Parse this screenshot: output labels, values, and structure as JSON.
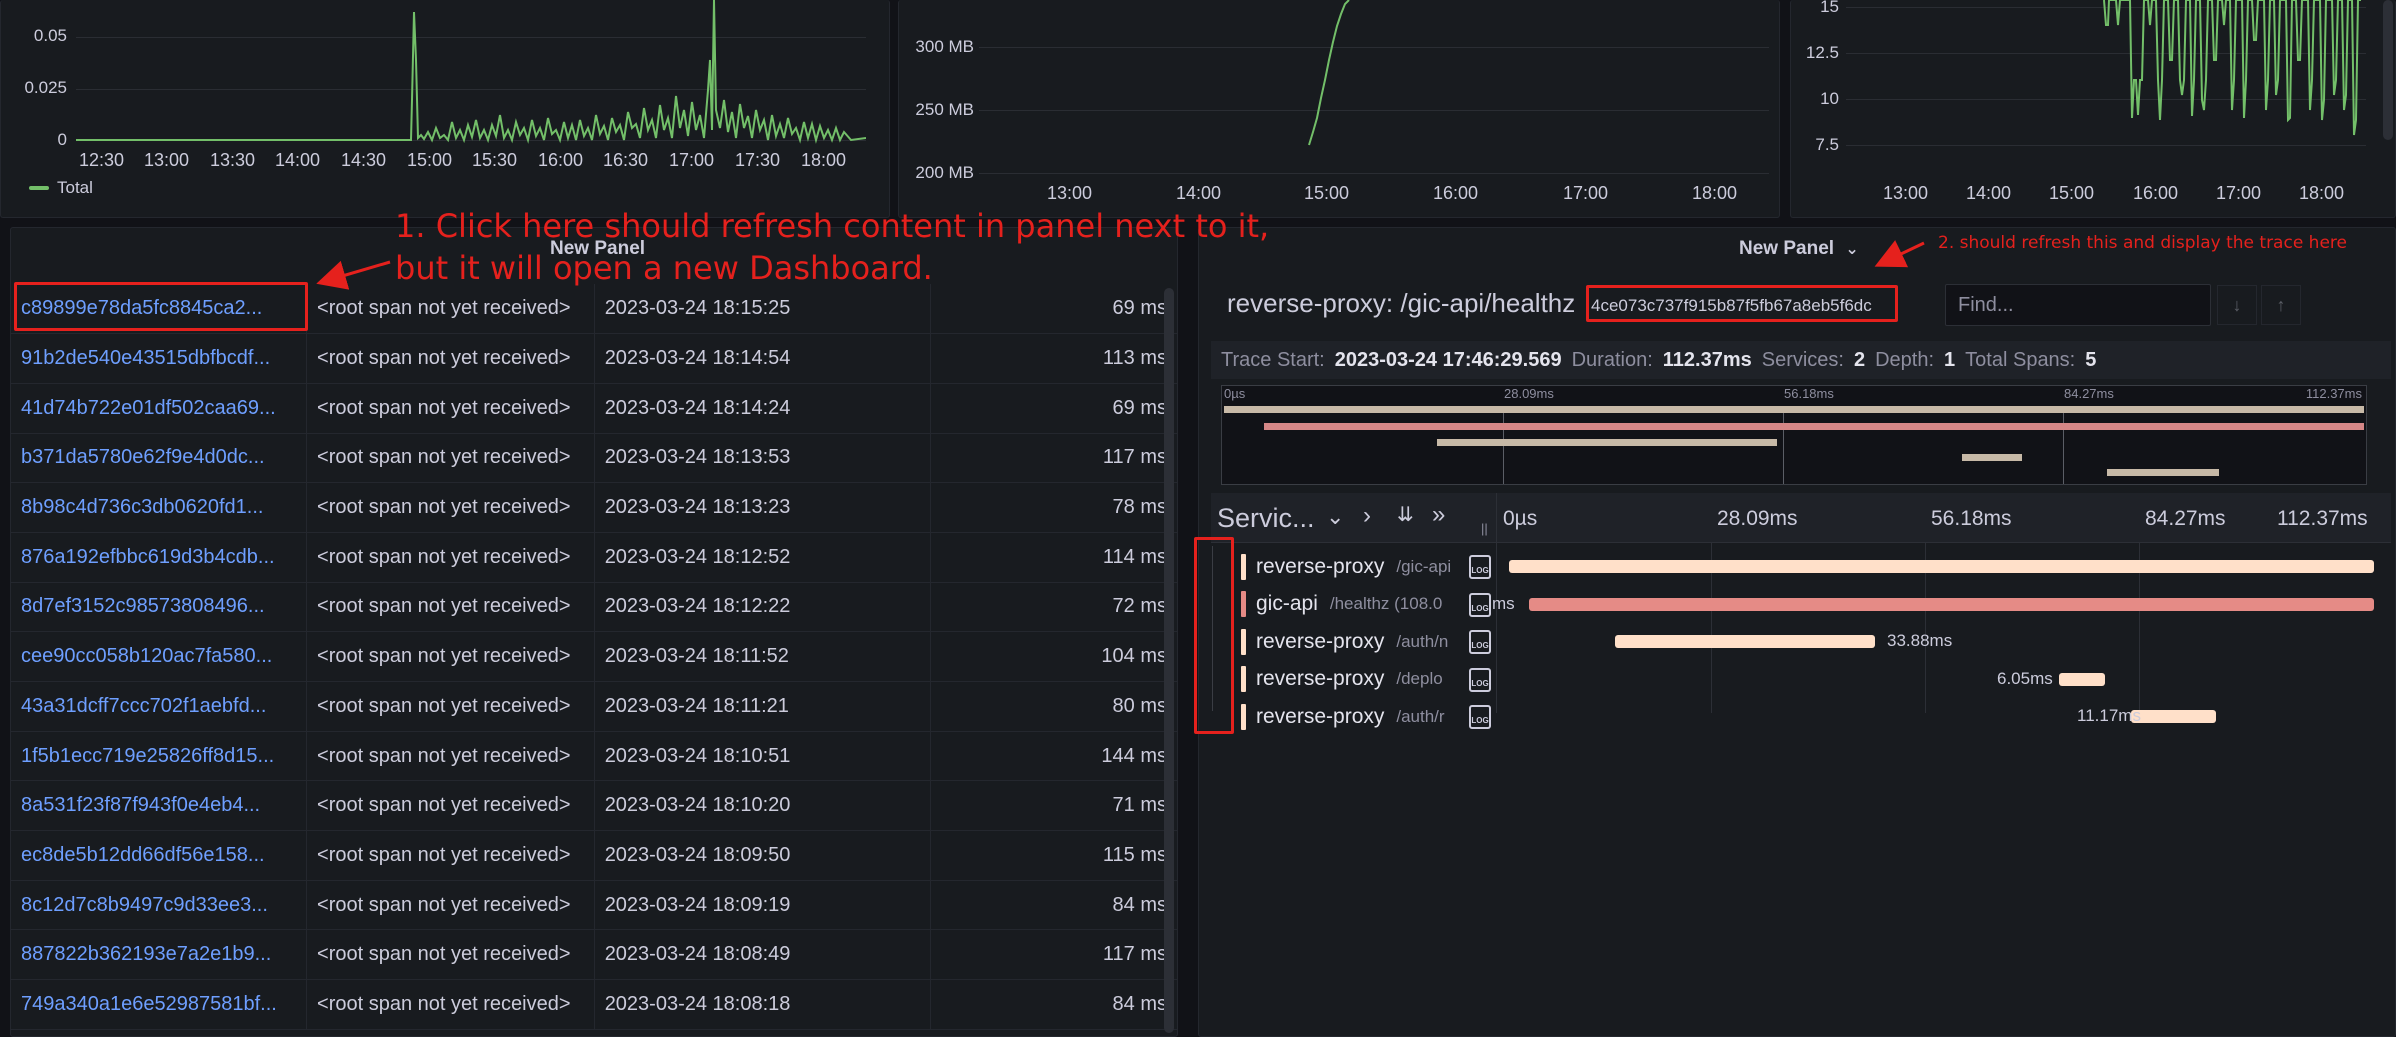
{
  "top_panels": {
    "left": {
      "y_ticks": [
        "0.05",
        "0.025",
        "0"
      ],
      "x_ticks": [
        "12:30",
        "13:00",
        "13:30",
        "14:00",
        "14:30",
        "15:00",
        "15:30",
        "16:00",
        "16:30",
        "17:00",
        "17:30",
        "18:00"
      ],
      "legend": "Total",
      "line_color": "#73bf69"
    },
    "middle": {
      "y_ticks": [
        "300 MB",
        "250 MB",
        "200 MB"
      ],
      "x_ticks": [
        "13:00",
        "14:00",
        "15:00",
        "16:00",
        "17:00",
        "18:00"
      ],
      "line_color": "#73bf69"
    },
    "right": {
      "y_ticks": [
        "15",
        "12.5",
        "10",
        "7.5"
      ],
      "x_ticks": [
        "13:00",
        "14:00",
        "15:00",
        "16:00",
        "17:00",
        "18:00"
      ],
      "line_color": "#73bf69"
    }
  },
  "traces_panel": {
    "title": "New Panel",
    "rows": [
      {
        "id": "c89899e78da5fc8845ca2...",
        "service": "<root span not yet received>",
        "time": "2023-03-24 18:15:25",
        "duration": "69 ms"
      },
      {
        "id": "91b2de540e43515dbfbcdf...",
        "service": "<root span not yet received>",
        "time": "2023-03-24 18:14:54",
        "duration": "113 ms"
      },
      {
        "id": "41d74b722e01df502caa69...",
        "service": "<root span not yet received>",
        "time": "2023-03-24 18:14:24",
        "duration": "69 ms"
      },
      {
        "id": "b371da5780e62f9e4d0dc...",
        "service": "<root span not yet received>",
        "time": "2023-03-24 18:13:53",
        "duration": "117 ms"
      },
      {
        "id": "8b98c4d736c3db0620fd1...",
        "service": "<root span not yet received>",
        "time": "2023-03-24 18:13:23",
        "duration": "78 ms"
      },
      {
        "id": "876a192efbbc619d3b4cdb...",
        "service": "<root span not yet received>",
        "time": "2023-03-24 18:12:52",
        "duration": "114 ms"
      },
      {
        "id": "8d7ef3152c98573808496...",
        "service": "<root span not yet received>",
        "time": "2023-03-24 18:12:22",
        "duration": "72 ms"
      },
      {
        "id": "cee90cc058b120ac7fa580...",
        "service": "<root span not yet received>",
        "time": "2023-03-24 18:11:52",
        "duration": "104 ms"
      },
      {
        "id": "43a31dcff7ccc702f1aebfd...",
        "service": "<root span not yet received>",
        "time": "2023-03-24 18:11:21",
        "duration": "80 ms"
      },
      {
        "id": "1f5b1ecc719e25826ff8d15...",
        "service": "<root span not yet received>",
        "time": "2023-03-24 18:10:51",
        "duration": "144 ms"
      },
      {
        "id": "8a531f23f87f943f0e4eb4...",
        "service": "<root span not yet received>",
        "time": "2023-03-24 18:10:20",
        "duration": "71 ms"
      },
      {
        "id": "ec8de5b12dd66df56e158...",
        "service": "<root span not yet received>",
        "time": "2023-03-24 18:09:50",
        "duration": "115 ms"
      },
      {
        "id": "8c12d7c8b9497c9d33ee3...",
        "service": "<root span not yet received>",
        "time": "2023-03-24 18:09:19",
        "duration": "84 ms"
      },
      {
        "id": "887822b362193e7a2e1b9...",
        "service": "<root span not yet received>",
        "time": "2023-03-24 18:08:49",
        "duration": "117 ms"
      },
      {
        "id": "749a340a1e6e52987581bf...",
        "service": "<root span not yet received>",
        "time": "2023-03-24 18:08:18",
        "duration": "84 ms"
      }
    ]
  },
  "trace_view": {
    "panel_title": "New Panel",
    "chevron": "⌄",
    "trace_title": "reverse-proxy: /gic-api/healthz",
    "trace_id": "4ce073c737f915b87f5fb67a8eb5f6dc",
    "find_placeholder": "Find...",
    "prev_icon": "↓",
    "next_icon": "↑",
    "meta": {
      "start_label": "Trace Start:",
      "start_value": "2023-03-24 17:46:29.569",
      "duration_label": "Duration:",
      "duration_value": "112.37ms",
      "services_label": "Services:",
      "services_value": "2",
      "depth_label": "Depth:",
      "depth_value": "1",
      "spans_label": "Total Spans:",
      "spans_value": "5"
    },
    "minimap_ticks": [
      "0µs",
      "28.09ms",
      "56.18ms",
      "84.27ms",
      "112.37ms"
    ],
    "header": {
      "service_label": "Servic...",
      "ticks": [
        "0µs",
        "28.09ms",
        "56.18ms",
        "84.27ms",
        "112.37ms"
      ],
      "resize_glyph": "||"
    },
    "spans": [
      {
        "service": "reverse-proxy",
        "op": "/gic-api",
        "color": "#ffe0c9",
        "label": ""
      },
      {
        "service": "gic-api",
        "op": "/healthz (108.0",
        "color": "#e58b86",
        "label": "ms"
      },
      {
        "service": "reverse-proxy",
        "op": "/auth/n",
        "color": "#ffe0c9",
        "label": "33.88ms"
      },
      {
        "service": "reverse-proxy",
        "op": "/deplo",
        "color": "#ffe0c9",
        "label": "6.05ms"
      },
      {
        "service": "reverse-proxy",
        "op": "/auth/r",
        "color": "#ffe0c9",
        "label": "11.17ms"
      }
    ],
    "log_icon_text": "LOG"
  },
  "annotations": {
    "note1_line1": "1. Click here should refresh content in panel next to it,",
    "note1_line2": "but it will open a new Dashboard.",
    "note2": "2. should refresh this and display the trace here",
    "color": "#e5211d"
  }
}
